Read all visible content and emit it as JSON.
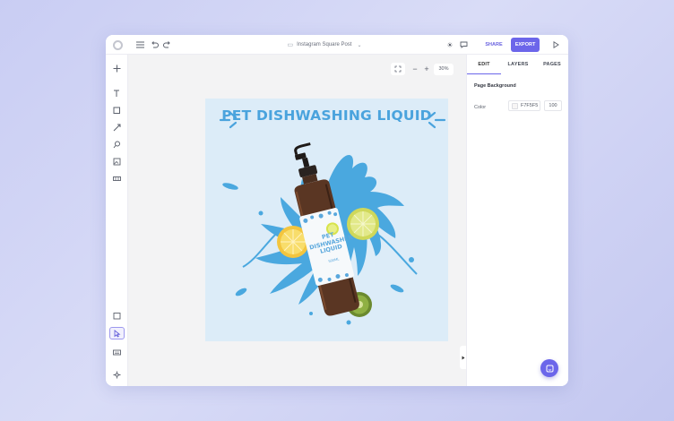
{
  "header": {
    "document_title": "Instagram Square Post",
    "share_label": "SHARE",
    "export_label": "EXPORT"
  },
  "canvas": {
    "zoom_label": "30%",
    "headline": "PET DISHWASHING LIQUID",
    "bottle_label": "PET DISHWASHER LIQUID",
    "bottle_volume": "500ML"
  },
  "panel": {
    "tabs": [
      {
        "label": "EDIT"
      },
      {
        "label": "LAYERS"
      },
      {
        "label": "PAGES"
      }
    ],
    "section_title": "Page Background",
    "color_label": "Color",
    "color_value": "F7F5F5",
    "opacity_value": "100"
  },
  "colors": {
    "accent": "#6c66ea",
    "headline": "#4aa3dd",
    "artboard_bg": "#dcecf8",
    "swatch": "#F7F5F5"
  },
  "icons": {
    "logo": "logo-icon",
    "menu": "hamburger-menu-icon",
    "undo": "undo-icon",
    "redo": "redo-icon",
    "theme": "sun-icon",
    "comments": "comment-icon",
    "preview": "play-icon",
    "help": "chat-help-icon"
  }
}
